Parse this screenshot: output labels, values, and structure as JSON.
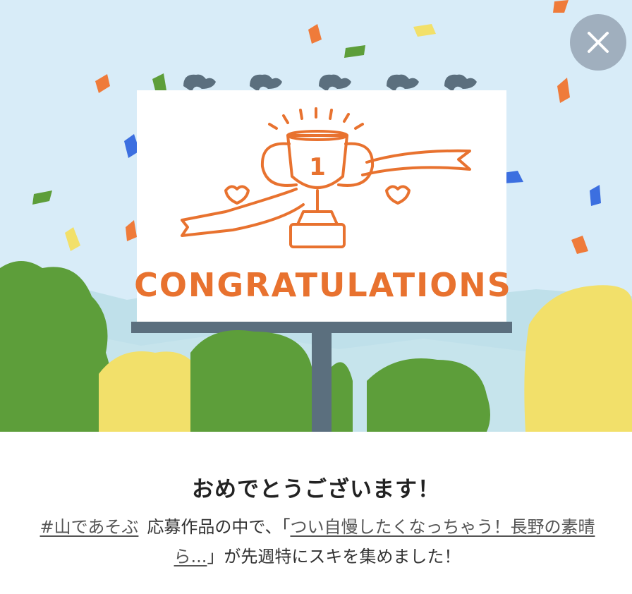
{
  "dialog": {
    "close_icon": "close-icon",
    "close_color": "#ffffff",
    "close_bg": "#96a5b4"
  },
  "hero": {
    "sign_text": "CONGRATULATIONS",
    "trophy_number": "1",
    "accent_color": "#e8722f",
    "sky_color": "#d8ecf8"
  },
  "message": {
    "title": "おめでとうございます！",
    "hashtag_link": "#山であそぶ",
    "text_1": "応募作品の中で、「",
    "article_link": "つい自慢したくなっちゃう！長野の素晴ら...",
    "text_2": "」が先週特にスキを集めました！"
  }
}
